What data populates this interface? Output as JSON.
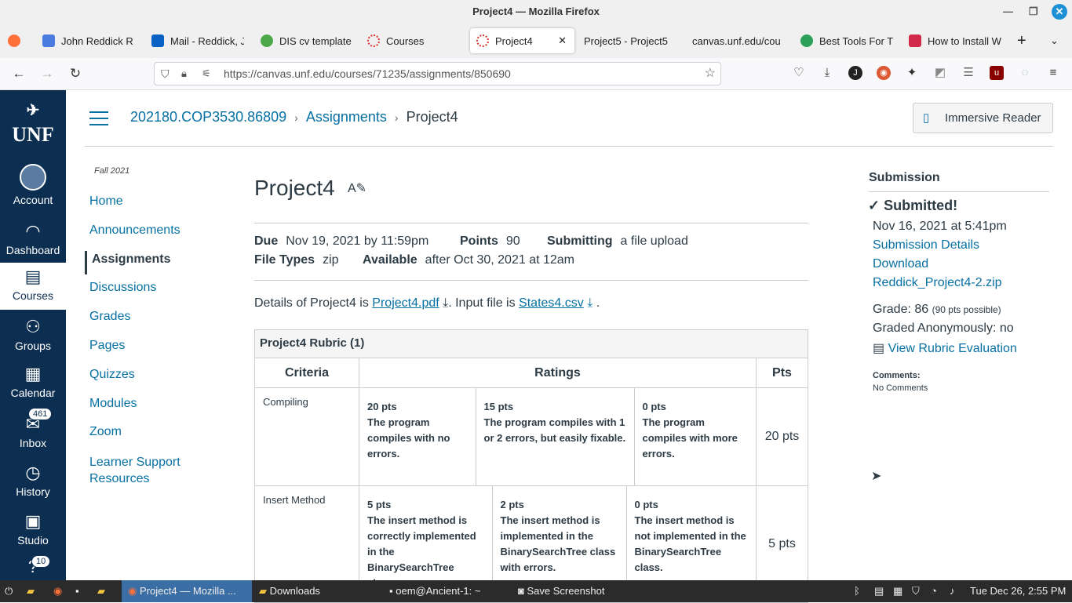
{
  "window": {
    "title": "Project4 — Mozilla Firefox"
  },
  "tabs": [
    {
      "label": "John Reddick R",
      "color": "#4a7ce0"
    },
    {
      "label": "Mail - Reddick, J",
      "color": "#0a62c4"
    },
    {
      "label": "DIS cv template",
      "color": "#4aa84a"
    },
    {
      "label": "Courses",
      "color": "#d9302a"
    },
    {
      "label": "Project4",
      "color": "#d9302a"
    },
    {
      "label": "Project5 - Project5",
      "color": "#ffffff"
    },
    {
      "label": "canvas.unf.edu/cou",
      "color": "#ffffff"
    },
    {
      "label": "Best Tools For T",
      "color": "#2aa058"
    },
    {
      "label": "How to Install W",
      "color": "#d22b4a"
    }
  ],
  "url": "https://canvas.unf.edu/courses/71235/assignments/850690",
  "global_nav": {
    "logo": "UNF",
    "items": [
      {
        "label": "Account",
        "icon": "avatar"
      },
      {
        "label": "Dashboard",
        "icon": "dashboard-icon"
      },
      {
        "label": "Courses",
        "icon": "courses-icon"
      },
      {
        "label": "Groups",
        "icon": "groups-icon"
      },
      {
        "label": "Calendar",
        "icon": "calendar-icon"
      },
      {
        "label": "Inbox",
        "icon": "inbox-icon"
      },
      {
        "label": "History",
        "icon": "history-icon"
      },
      {
        "label": "Studio",
        "icon": "studio-icon"
      }
    ],
    "inbox_badge": "461",
    "help_badge": "10"
  },
  "breadcrumbs": [
    "202180.COP3530.86809",
    "Assignments",
    "Project4"
  ],
  "immersive_reader": "Immersive Reader",
  "course_nav": {
    "term": "Fall 2021",
    "items": [
      "Home",
      "Announcements",
      "Assignments",
      "Discussions",
      "Grades",
      "Pages",
      "Quizzes",
      "Modules",
      "Zoom",
      "Learner Support",
      "Resources"
    ]
  },
  "assignment": {
    "title": "Project4",
    "due_label": "Due",
    "due": "Nov 19, 2021 by 11:59pm",
    "points_label": "Points",
    "points": "90",
    "submitting_label": "Submitting",
    "submitting": "a file upload",
    "filetypes_label": "File Types",
    "filetypes": "zip",
    "available_label": "Available",
    "available": "after Oct 30, 2021 at 12am",
    "details_pre": "Details of Project4 is",
    "details_link": "Project4.pdf",
    "input_pre": ". Input file is",
    "input_link": "States4.csv",
    "input_post": "."
  },
  "rubric": {
    "caption": "Project4 Rubric (1)",
    "headers": [
      "Criteria",
      "Ratings",
      "Pts"
    ],
    "rows": [
      {
        "criteria": "Compiling",
        "pts": "20 pts",
        "ratings": [
          {
            "pts": "20 pts",
            "desc": "The program compiles with no errors."
          },
          {
            "pts": "15 pts",
            "desc": "The program compiles with 1 or 2 errors, but easily fixable."
          },
          {
            "pts": "0 pts",
            "desc": "The program compiles with more errors."
          }
        ]
      },
      {
        "criteria": "Insert Method",
        "pts": "5 pts",
        "ratings": [
          {
            "pts": "5 pts",
            "desc": "The insert method is correctly implemented in the BinarySearchTree class."
          },
          {
            "pts": "2 pts",
            "desc": "The insert method is implemented in the BinarySearchTree class with errors."
          },
          {
            "pts": "0 pts",
            "desc": "The insert method is not implemented in the BinarySearchTree class."
          }
        ]
      }
    ]
  },
  "submission": {
    "heading": "Submission",
    "status": "Submitted!",
    "date": "Nov 16, 2021 at 5:41pm",
    "details_link": "Submission Details",
    "download": "Download",
    "file": "Reddick_Project4-2.zip",
    "grade_label": "Grade: 86",
    "grade_possible": "(90 pts possible)",
    "anon": "Graded Anonymously: no",
    "rubric_link": "View Rubric Evaluation",
    "comments_label": "Comments:",
    "comments": "No Comments"
  },
  "taskbar": {
    "items": [
      "Project4 — Mozilla ...",
      "Downloads",
      "oem@Ancient-1: ~",
      "Save Screenshot"
    ],
    "clock": "Tue Dec 26,  2:55 PM"
  }
}
